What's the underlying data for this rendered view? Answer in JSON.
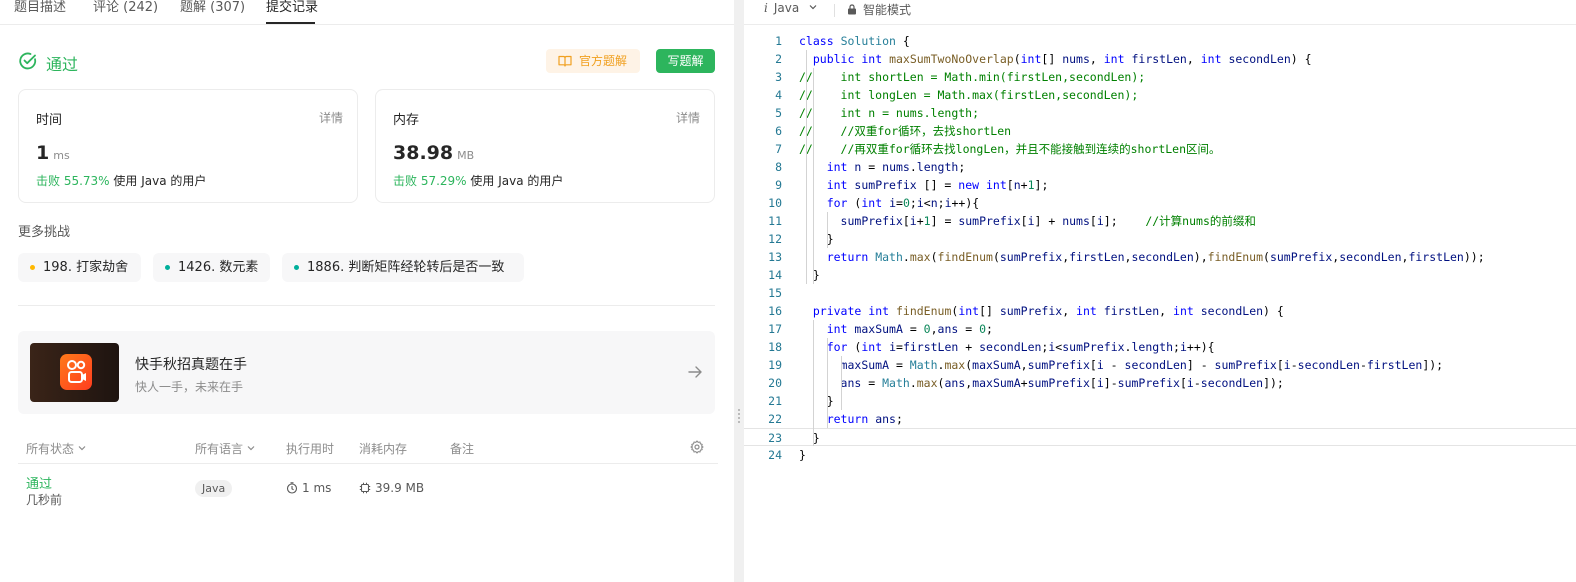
{
  "tabs": [
    {
      "label": "题目描述"
    },
    {
      "label": "评论 (242)"
    },
    {
      "label": "题解 (307)"
    },
    {
      "label": "提交记录"
    }
  ],
  "status": {
    "label": "通过",
    "color": "#2db55d"
  },
  "buttons": {
    "official": "官方题解",
    "write": "写题解"
  },
  "cards": {
    "time": {
      "title": "时间",
      "detail": "详情",
      "value": "1",
      "unit": "ms",
      "beat_prefix": "击败 55.73%",
      "beat_suffix": " 使用 Java 的用户"
    },
    "memory": {
      "title": "内存",
      "detail": "详情",
      "value": "38.98",
      "unit": "MB",
      "beat_prefix": "击败 57.29%",
      "beat_suffix": " 使用 Java 的用户"
    }
  },
  "more": {
    "title": "更多挑战",
    "chips": [
      {
        "label": "198. 打家劫舍",
        "dot": "#ffb800"
      },
      {
        "label": "1426. 数元素",
        "dot": "#00af9b"
      },
      {
        "label": "1886. 判断矩阵经轮转后是否一致",
        "dot": "#00af9b"
      }
    ]
  },
  "banner": {
    "title": "快手秋招真题在手",
    "subtitle": "快人一手，未来在手"
  },
  "table": {
    "headers": {
      "status": "所有状态",
      "language": "所有语言",
      "runtime": "执行用时",
      "memory": "消耗内存",
      "notes": "备注"
    },
    "rows": [
      {
        "status": "通过",
        "time_ago": "几秒前",
        "language": "Java",
        "runtime": "1 ms",
        "memory": "39.9 MB"
      }
    ]
  },
  "editor": {
    "language": "Java",
    "mode": "智能模式"
  },
  "code_lines": [
    {
      "n": "1",
      "text": "class Solution {"
    },
    {
      "n": "2",
      "text": "  public int maxSumTwoNoOverlap(int[] nums, int firstLen, int secondLen) {"
    },
    {
      "n": "3",
      "text": "//    int shortLen = Math.min(firstLen,secondLen);"
    },
    {
      "n": "4",
      "text": "//    int longLen = Math.max(firstLen,secondLen);"
    },
    {
      "n": "5",
      "text": "//    int n = nums.length;"
    },
    {
      "n": "6",
      "text": "//    //双重for循环，去找shortLen"
    },
    {
      "n": "7",
      "text": "//    //再双重for循环去找longLen，并且不能接触到连续的shortLen区间。"
    },
    {
      "n": "8",
      "text": "    int n = nums.length;"
    },
    {
      "n": "9",
      "text": "    int sumPrefix [] = new int[n+1];"
    },
    {
      "n": "10",
      "text": "    for (int i=0;i<n;i++){"
    },
    {
      "n": "11",
      "text": "      sumPrefix[i+1] = sumPrefix[i] + nums[i];    //计算nums的前缀和"
    },
    {
      "n": "12",
      "text": "    }"
    },
    {
      "n": "13",
      "text": "    return Math.max(findEnum(sumPrefix,firstLen,secondLen),findEnum(sumPrefix,secondLen,firstLen));"
    },
    {
      "n": "14",
      "text": "  }"
    },
    {
      "n": "15",
      "text": ""
    },
    {
      "n": "16",
      "text": "  private int findEnum(int[] sumPrefix, int firstLen, int secondLen) {"
    },
    {
      "n": "17",
      "text": "    int maxSumA = 0,ans = 0;"
    },
    {
      "n": "18",
      "text": "    for (int i=firstLen + secondLen;i<sumPrefix.length;i++){"
    },
    {
      "n": "19",
      "text": "      maxSumA = Math.max(maxSumA,sumPrefix[i - secondLen] - sumPrefix[i-secondLen-firstLen]);"
    },
    {
      "n": "20",
      "text": "      ans = Math.max(ans,maxSumA+sumPrefix[i]-sumPrefix[i-secondLen]);"
    },
    {
      "n": "21",
      "text": "    }"
    },
    {
      "n": "22",
      "text": "    return ans;"
    },
    {
      "n": "23",
      "text": "  }"
    },
    {
      "n": "24",
      "text": "}"
    }
  ]
}
